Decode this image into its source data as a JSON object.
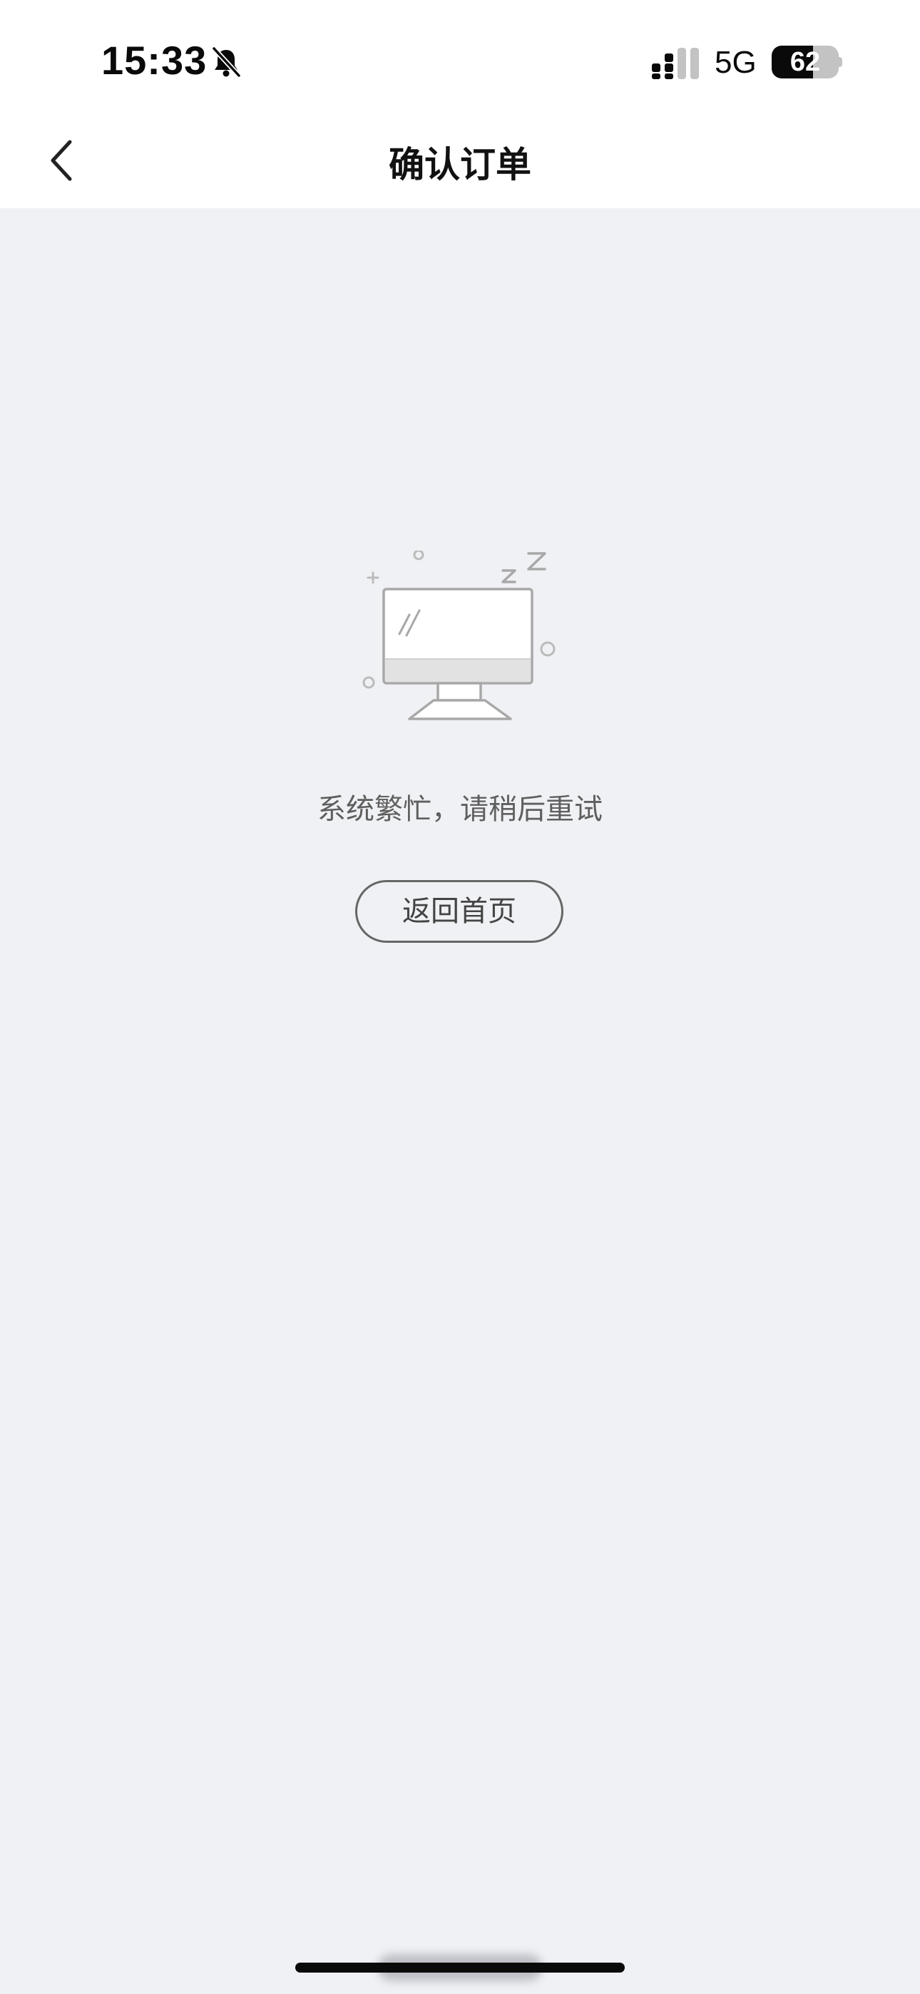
{
  "status_bar": {
    "time": "15:33",
    "network": "5G",
    "battery_level": "62",
    "battery_fraction": 0.62,
    "icons": [
      "bell-slash-icon",
      "cellular-signal-icon"
    ]
  },
  "nav": {
    "title": "确认订单",
    "back_icon": "chevron-left-icon"
  },
  "content": {
    "illustration": "sleeping-computer-icon",
    "message": "系统繁忙，请稍后重试",
    "home_button_label": "返回首页"
  },
  "colors": {
    "background": "#f0f1f4",
    "header": "#ffffff",
    "text_primary": "#111111",
    "text_secondary": "#5f5f5f",
    "illustration_stroke": "#a8a8a8"
  }
}
